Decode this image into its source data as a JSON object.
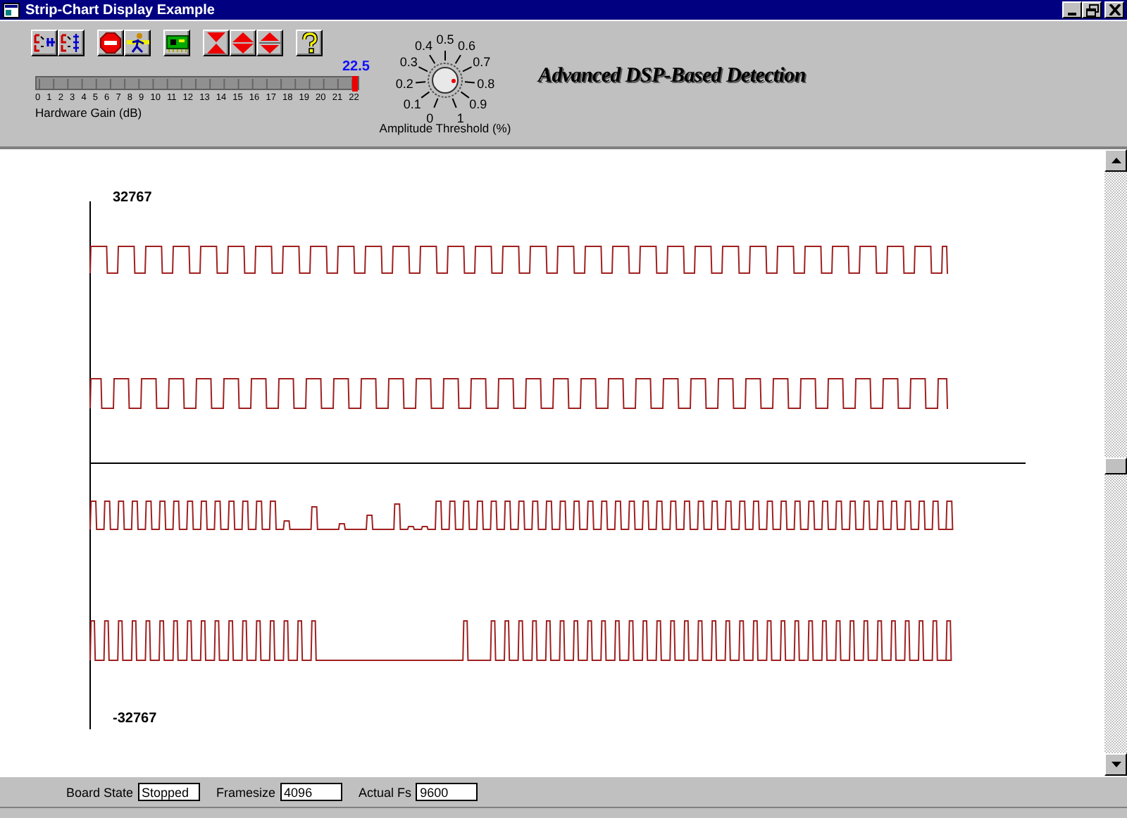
{
  "window": {
    "title": "Strip-Chart Display Example"
  },
  "toolbar": {
    "groups": [
      [
        {
          "kind": "channels-in"
        },
        {
          "kind": "channels-out"
        }
      ],
      [
        {
          "kind": "stop"
        },
        {
          "kind": "run"
        }
      ],
      [
        {
          "kind": "board"
        }
      ],
      [
        {
          "kind": "zoom-in"
        },
        {
          "kind": "zoom-out"
        },
        {
          "kind": "split"
        }
      ],
      [
        {
          "kind": "help"
        }
      ]
    ]
  },
  "gain_slider": {
    "value": "22.5",
    "level": 1,
    "ticks": [
      "0",
      "1",
      "2",
      "3",
      "4",
      "5",
      "6",
      "7",
      "8",
      "9",
      "10",
      "11",
      "12",
      "13",
      "14",
      "15",
      "16",
      "17",
      "18",
      "19",
      "20",
      "21",
      "22"
    ],
    "label": "Hardware Gain (dB)"
  },
  "threshold_knob": {
    "level": 0.8,
    "ticks": [
      "0",
      "0.1",
      "0.2",
      "0.3",
      "0.4",
      "0.5",
      "0.6",
      "0.7",
      "0.8",
      "0.9",
      "1"
    ],
    "label": "Amplitude Threshold (%)"
  },
  "heading": "Advanced DSP-Based Detection",
  "chart": {
    "top_label": "32767",
    "bottom_label": "-32767"
  },
  "status_bar": {
    "fields": [
      {
        "label": "Board State",
        "value": "Stopped"
      },
      {
        "label": "Framesize",
        "value": "4096"
      },
      {
        "label": "Actual Fs",
        "value": "9600"
      }
    ]
  }
}
